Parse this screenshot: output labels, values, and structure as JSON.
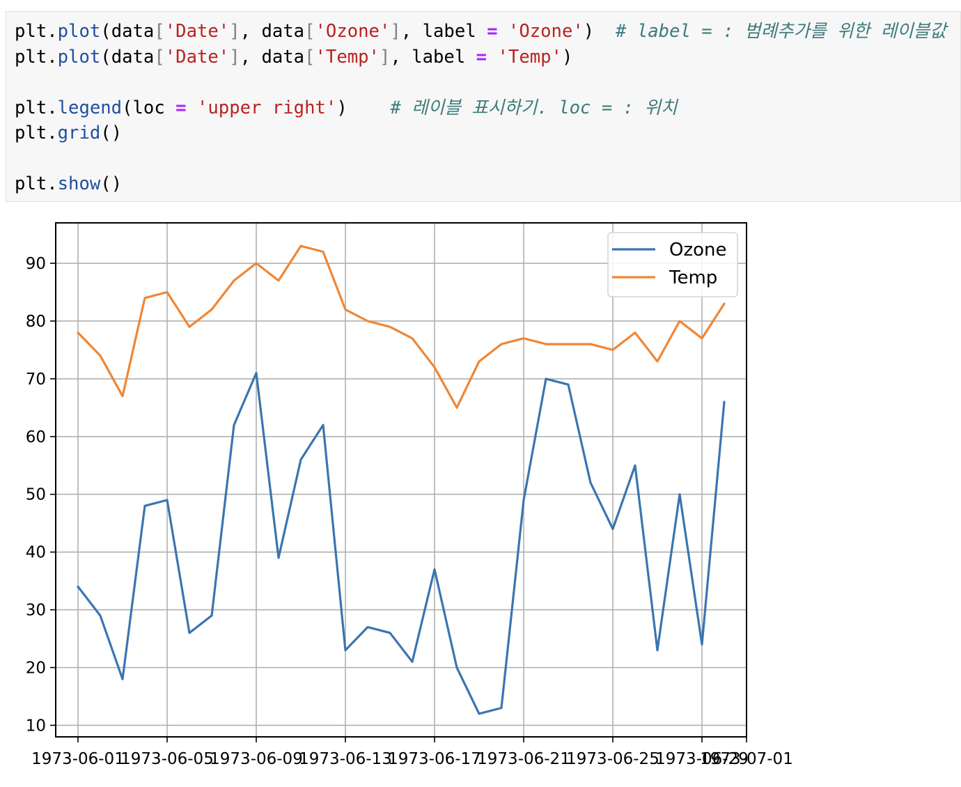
{
  "code_cell": {
    "lines": [
      [
        {
          "t": "plt.",
          "c": ""
        },
        {
          "t": "plot",
          "c": "fn"
        },
        {
          "t": "(data",
          "c": ""
        },
        {
          "t": "[",
          "c": "br"
        },
        {
          "t": "'Date'",
          "c": "str"
        },
        {
          "t": "]",
          "c": "br"
        },
        {
          "t": ", data",
          "c": ""
        },
        {
          "t": "[",
          "c": "br"
        },
        {
          "t": "'Ozone'",
          "c": "str"
        },
        {
          "t": "]",
          "c": "br"
        },
        {
          "t": ", label ",
          "c": ""
        },
        {
          "t": "=",
          "c": "op"
        },
        {
          "t": " ",
          "c": ""
        },
        {
          "t": "'Ozone'",
          "c": "str"
        },
        {
          "t": ")  ",
          "c": ""
        },
        {
          "t": "# label = : 범례추가를 위한 레이블값",
          "c": "cm"
        }
      ],
      [
        {
          "t": "plt.",
          "c": ""
        },
        {
          "t": "plot",
          "c": "fn"
        },
        {
          "t": "(data",
          "c": ""
        },
        {
          "t": "[",
          "c": "br"
        },
        {
          "t": "'Date'",
          "c": "str"
        },
        {
          "t": "]",
          "c": "br"
        },
        {
          "t": ", data",
          "c": ""
        },
        {
          "t": "[",
          "c": "br"
        },
        {
          "t": "'Temp'",
          "c": "str"
        },
        {
          "t": "]",
          "c": "br"
        },
        {
          "t": ", label ",
          "c": ""
        },
        {
          "t": "=",
          "c": "op"
        },
        {
          "t": " ",
          "c": ""
        },
        {
          "t": "'Temp'",
          "c": "str"
        },
        {
          "t": ")",
          "c": ""
        }
      ],
      [],
      [
        {
          "t": "plt.",
          "c": ""
        },
        {
          "t": "legend",
          "c": "fn"
        },
        {
          "t": "(loc ",
          "c": ""
        },
        {
          "t": "=",
          "c": "op"
        },
        {
          "t": " ",
          "c": ""
        },
        {
          "t": "'upper right'",
          "c": "str"
        },
        {
          "t": ")    ",
          "c": ""
        },
        {
          "t": "# 레이블 표시하기. loc = : 위치",
          "c": "cm"
        }
      ],
      [
        {
          "t": "plt.",
          "c": ""
        },
        {
          "t": "grid",
          "c": "fn"
        },
        {
          "t": "()",
          "c": ""
        }
      ],
      [],
      [
        {
          "t": "plt.",
          "c": ""
        },
        {
          "t": "show",
          "c": "fn"
        },
        {
          "t": "()",
          "c": ""
        }
      ]
    ]
  },
  "chart_data": {
    "type": "line",
    "x": [
      "1973-06-01",
      "1973-06-02",
      "1973-06-03",
      "1973-06-04",
      "1973-06-05",
      "1973-06-06",
      "1973-06-07",
      "1973-06-08",
      "1973-06-09",
      "1973-06-10",
      "1973-06-11",
      "1973-06-12",
      "1973-06-13",
      "1973-06-14",
      "1973-06-15",
      "1973-06-16",
      "1973-06-17",
      "1973-06-18",
      "1973-06-19",
      "1973-06-20",
      "1973-06-21",
      "1973-06-22",
      "1973-06-23",
      "1973-06-24",
      "1973-06-25",
      "1973-06-26",
      "1973-06-27",
      "1973-06-28",
      "1973-06-29",
      "1973-06-30"
    ],
    "series": [
      {
        "name": "Ozone",
        "color": "#3a75b0",
        "values": [
          34,
          29,
          18,
          48,
          49,
          26,
          29,
          62,
          71,
          39,
          56,
          62,
          23,
          27,
          26,
          21,
          37,
          20,
          12,
          13,
          49,
          70,
          69,
          52,
          44,
          55,
          23,
          50,
          24,
          66
        ]
      },
      {
        "name": "Temp",
        "color": "#f08634",
        "values": [
          78,
          74,
          67,
          84,
          85,
          79,
          82,
          87,
          90,
          87,
          93,
          92,
          82,
          80,
          79,
          77,
          72,
          65,
          73,
          76,
          77,
          76,
          76,
          76,
          75,
          78,
          73,
          80,
          77,
          83
        ]
      }
    ],
    "x_tick_labels": [
      "1973-06-01",
      "1973-06-05",
      "1973-06-09",
      "1973-06-13",
      "1973-06-17",
      "1973-06-21",
      "1973-06-25",
      "1973-06-29",
      "1973-07-01"
    ],
    "x_tick_dates": [
      "1973-06-01",
      "1973-06-05",
      "1973-06-09",
      "1973-06-13",
      "1973-06-17",
      "1973-06-21",
      "1973-06-25",
      "1973-06-29",
      "1973-07-01"
    ],
    "y_ticks": [
      10,
      20,
      30,
      40,
      50,
      60,
      70,
      80,
      90
    ],
    "xlim": [
      "1973-05-31",
      "1973-07-01"
    ],
    "ylim": [
      8,
      97
    ],
    "grid": true,
    "legend_position": "upper right"
  }
}
